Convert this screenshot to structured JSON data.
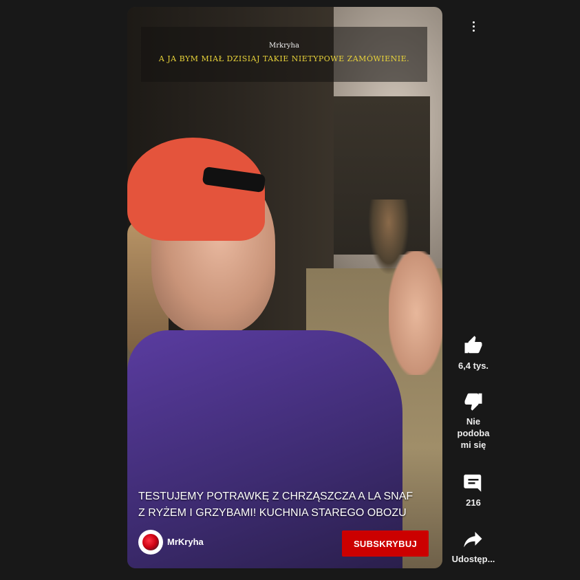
{
  "video": {
    "game_dialog": {
      "speaker": "Mrkryha",
      "line": "A JA BYM MIAŁ DZISIAJ TAKIE NIETYPOWE ZAMÓWIENIE."
    },
    "title_line1": "TESTUJEMY POTRAWKĘ Z CHRZĄSZCZA A LA SNAF",
    "title_line2": "Z RYŻEM I GRZYBAMI! KUCHNIA STAREGO OBOZU",
    "channel_name": "MrKryha",
    "subscribe_label": "SUBSKRYBUJ"
  },
  "actions": {
    "like_count": "6,4 tys.",
    "dislike_label_line1": "Nie",
    "dislike_label_line2": "podoba",
    "dislike_label_line3": "mi się",
    "comments_count": "216",
    "share_label": "Udostęp..."
  },
  "colors": {
    "background": "#181818",
    "subscribe": "#cc0000",
    "dialog_text": "#e8d33a"
  }
}
